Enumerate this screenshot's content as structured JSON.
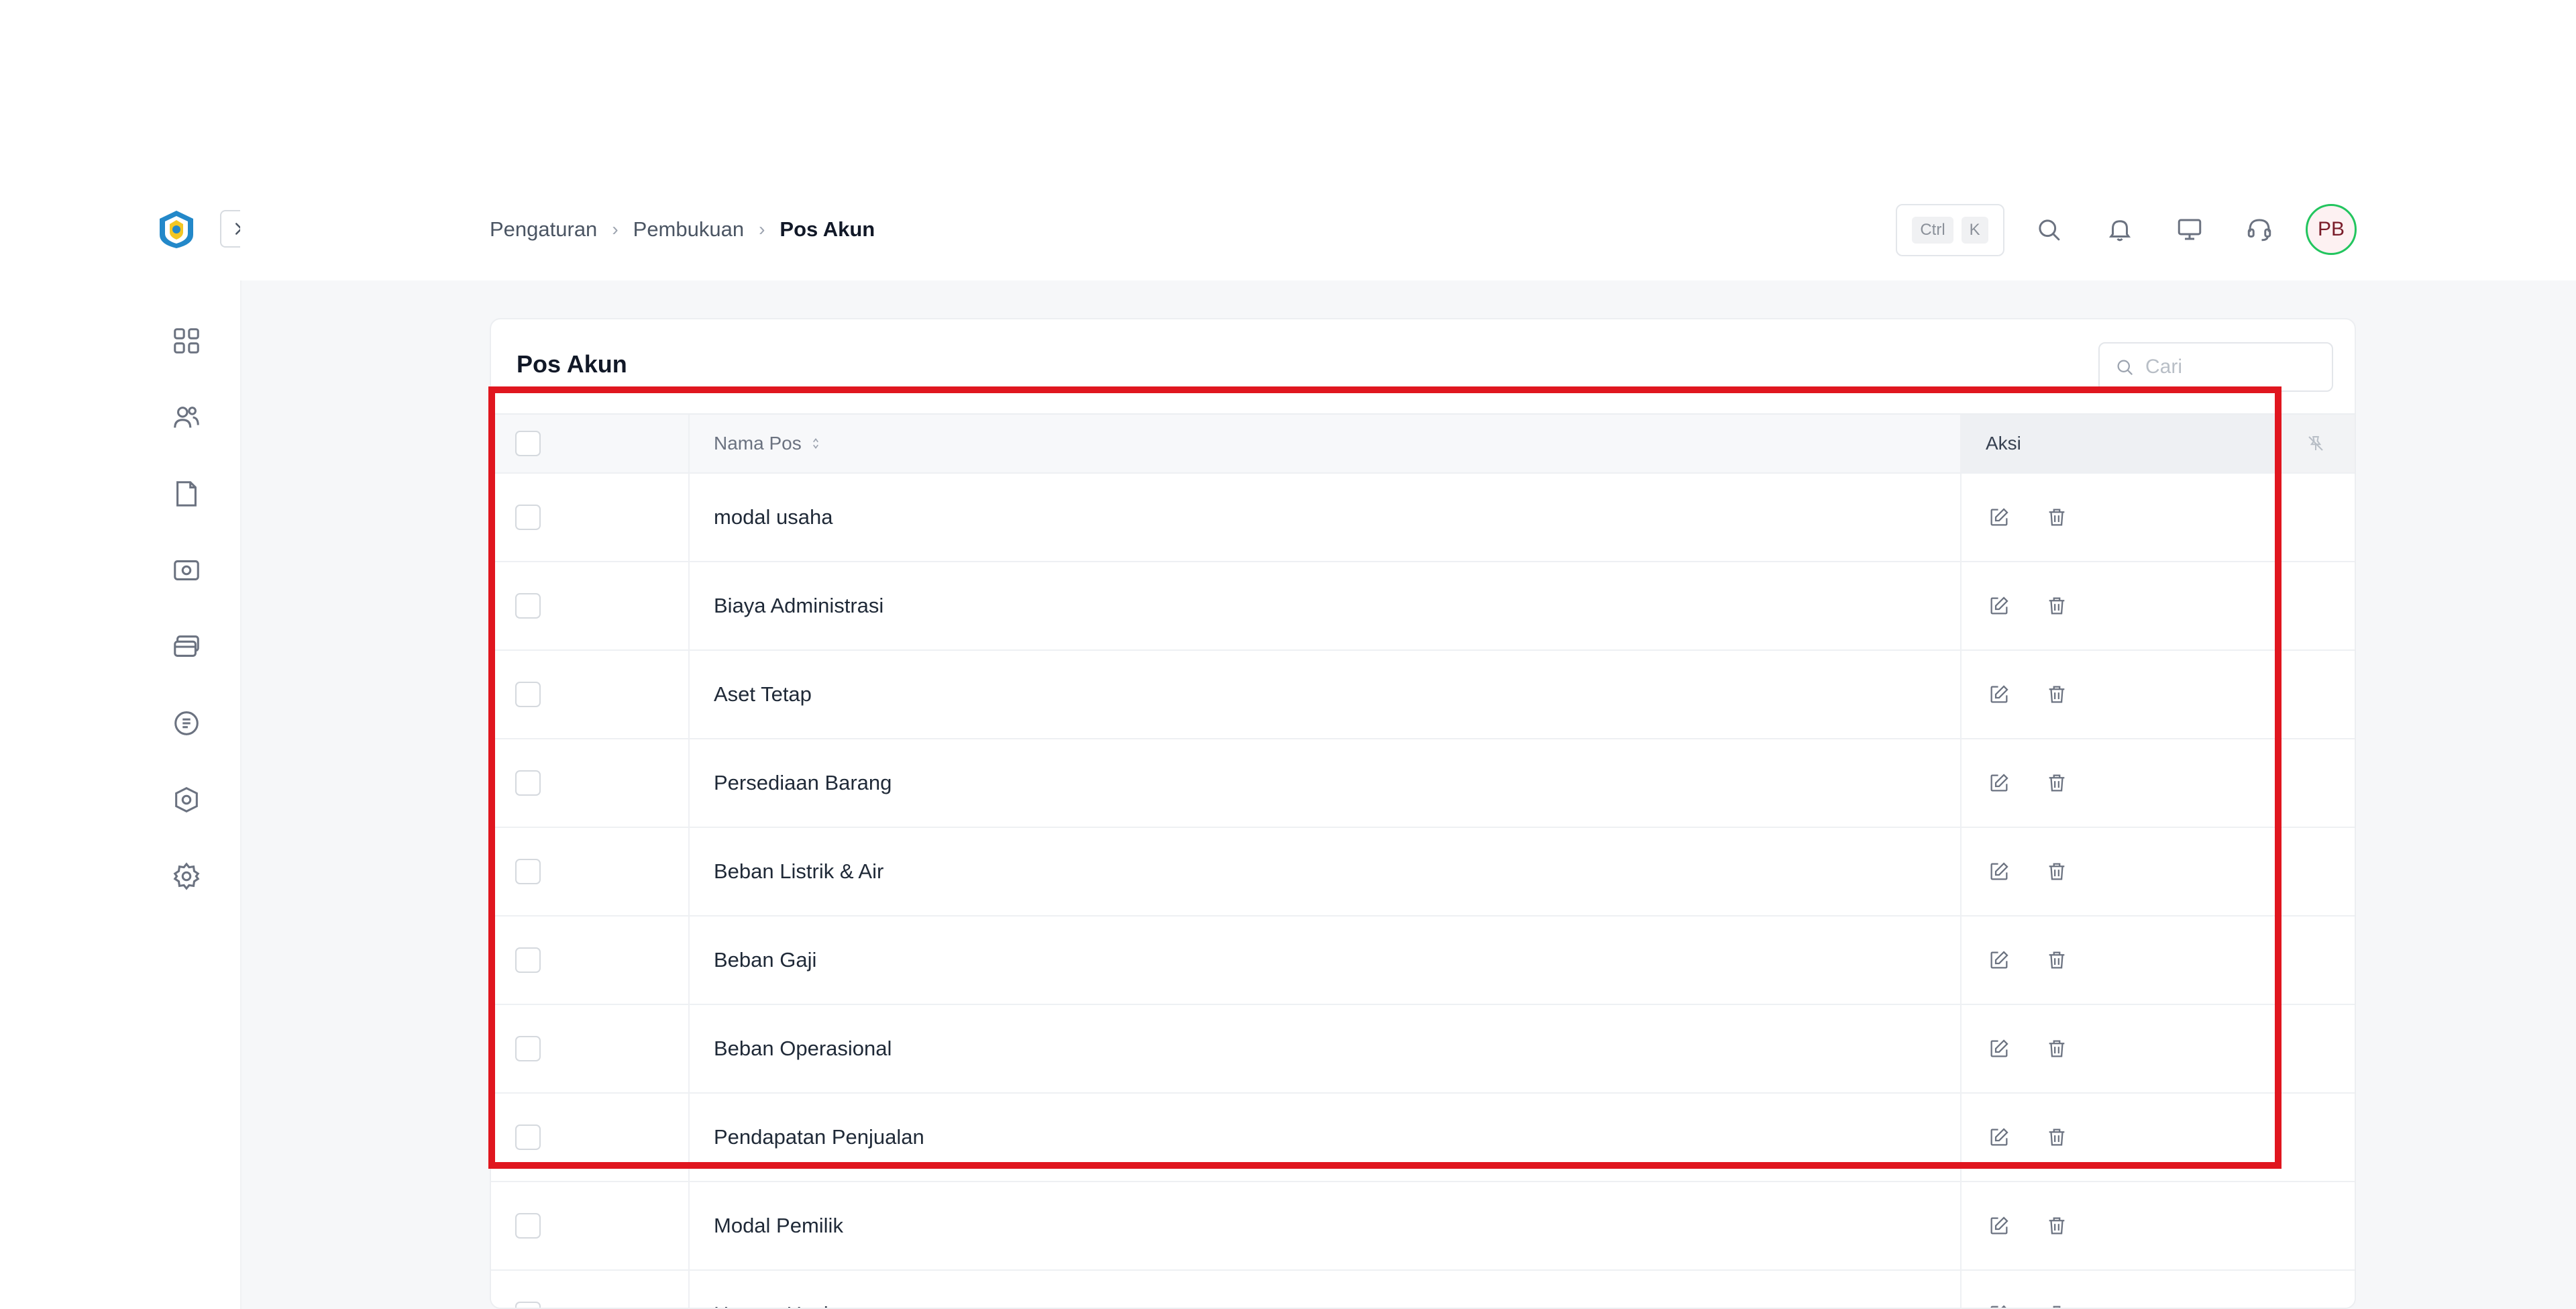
{
  "nav": {
    "collapse_label": "Toggle sidebar",
    "items": [
      {
        "icon": "dashboard-icon"
      },
      {
        "icon": "users-icon"
      },
      {
        "icon": "document-icon"
      },
      {
        "icon": "cash-icon"
      },
      {
        "icon": "cards-icon"
      },
      {
        "icon": "receipt-icon"
      },
      {
        "icon": "box-icon"
      },
      {
        "icon": "settings-icon"
      }
    ]
  },
  "breadcrumb": {
    "items": [
      "Pengaturan",
      "Pembukuan"
    ],
    "current": "Pos Akun"
  },
  "header": {
    "shortcut_key1": "Ctrl",
    "shortcut_key2": "K",
    "avatar_initials": "PB"
  },
  "card": {
    "title": "Pos Akun",
    "search_placeholder": "Cari"
  },
  "table": {
    "columns": {
      "name": "Nama Pos",
      "action": "Aksi"
    },
    "rows": [
      "modal usaha",
      "Biaya Administrasi",
      "Aset Tetap",
      "Persediaan Barang",
      "Beban Listrik & Air",
      "Beban Gaji",
      "Beban Operasional",
      "Pendapatan Penjualan",
      "Modal Pemilik",
      "Hutang Usaha"
    ]
  },
  "colors": {
    "highlight": "#e0161f",
    "avatar_ring": "#22c55e",
    "background": "#f6f7f9"
  }
}
